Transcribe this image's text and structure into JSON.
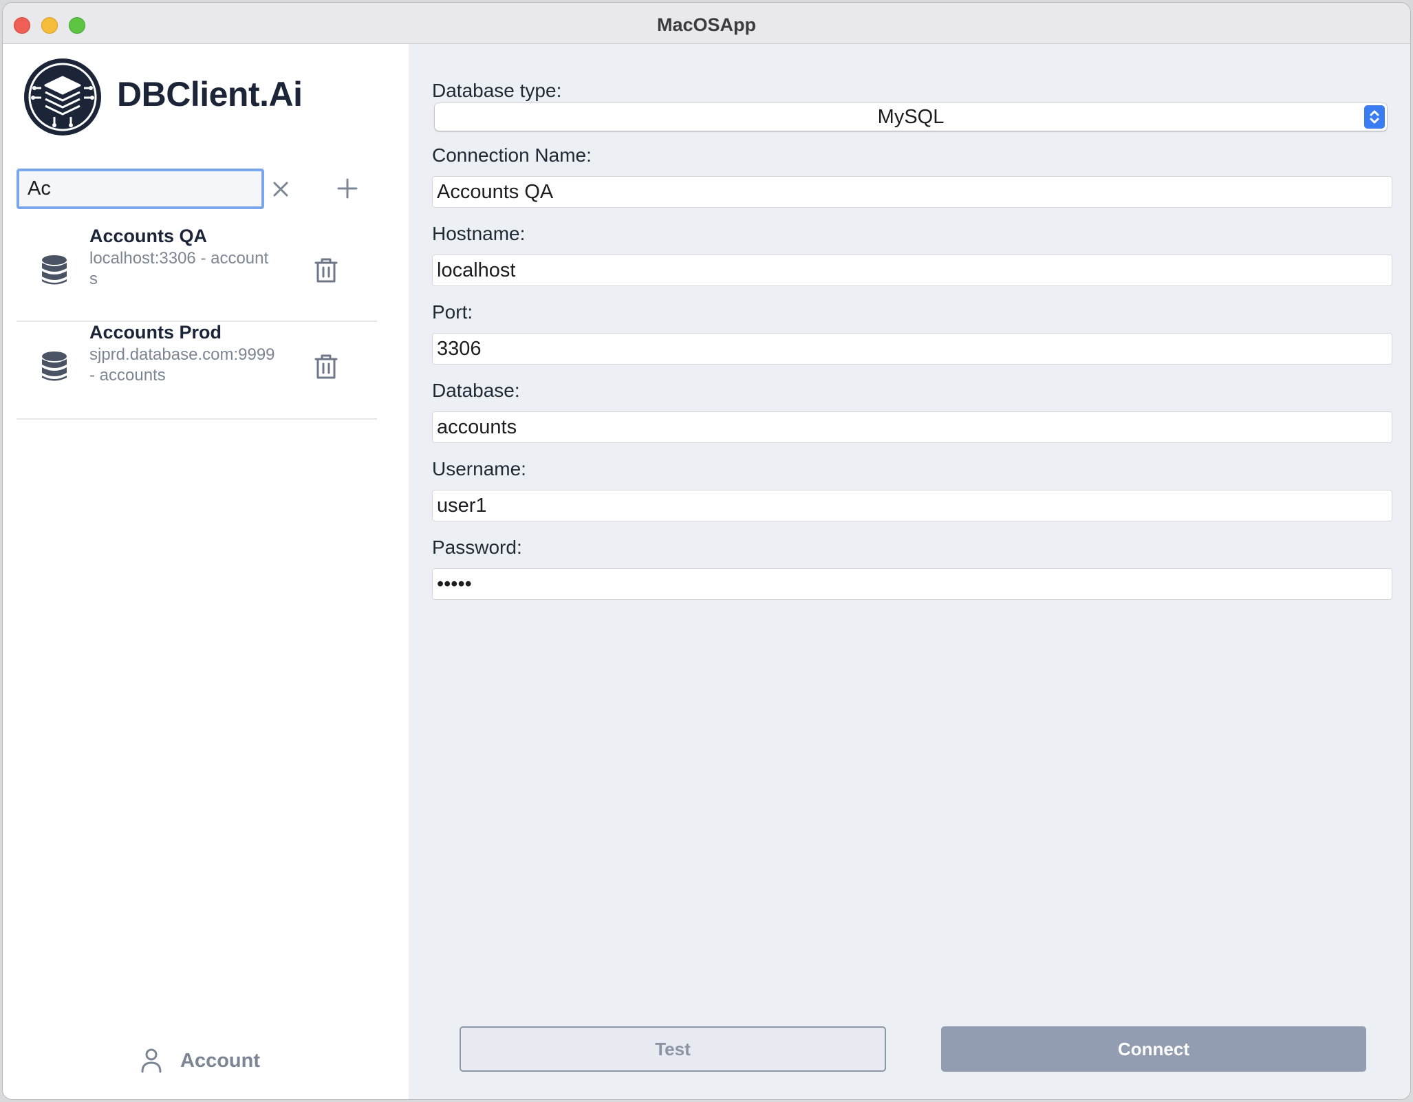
{
  "window": {
    "title": "MacOSApp"
  },
  "sidebar": {
    "brand": "DBClient.Ai",
    "search": {
      "value": "Ac",
      "placeholder": ""
    },
    "connections": [
      {
        "name": "Accounts QA",
        "detail": "localhost:3306 - accounts"
      },
      {
        "name": "Accounts Prod",
        "detail": "sjprd.database.com:9999 - accounts"
      }
    ],
    "account_label": "Account"
  },
  "form": {
    "db_type_label": "Database type:",
    "db_type_value": "MySQL",
    "connection_name_label": "Connection Name:",
    "connection_name_value": "Accounts QA",
    "hostname_label": "Hostname:",
    "hostname_value": "localhost",
    "port_label": "Port:",
    "port_value": "3306",
    "database_label": "Database:",
    "database_value": "accounts",
    "username_label": "Username:",
    "username_value": "user1",
    "password_label": "Password:",
    "password_value": "•••••",
    "test_label": "Test",
    "connect_label": "Connect"
  },
  "colors": {
    "accent": "#3a7cf2",
    "brand_text": "#1c2538",
    "connect_button": "#929db1",
    "form_background": "#eceff3"
  }
}
